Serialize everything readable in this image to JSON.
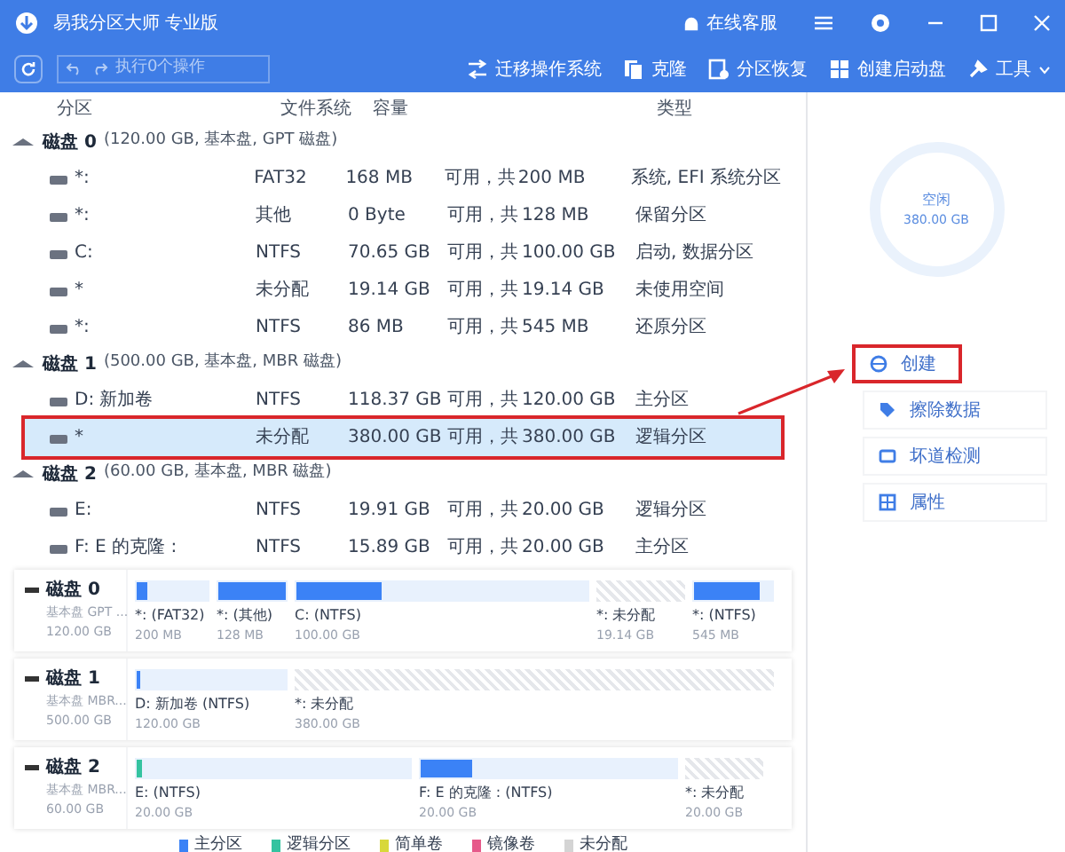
{
  "window": {
    "title": "易我分区大师 专业版",
    "support": "在线客服"
  },
  "toolbar": {
    "pending": "执行0个操作",
    "actions": [
      {
        "label": "迁移操作系统",
        "kind": "migrate"
      },
      {
        "label": "克隆",
        "kind": "clone"
      },
      {
        "label": "分区恢复",
        "kind": "recover"
      },
      {
        "label": "创建启动盘",
        "kind": "boot"
      },
      {
        "label": "工具",
        "kind": "tools"
      }
    ]
  },
  "table": {
    "columns": [
      "分区",
      "文件系统",
      "容量",
      "类型"
    ],
    "rows": [
      {
        "kind": "disk",
        "name": "磁盘 0",
        "info": "(120.00 GB, 基本盘, GPT 磁盘)"
      },
      {
        "kind": "partition",
        "name": "*:",
        "fs": "FAT32",
        "free": "168 MB",
        "sep": "可用，共",
        "total": "200 MB",
        "type": "系统, EFI 系统分区",
        "selected": false
      },
      {
        "kind": "partition",
        "name": "*:",
        "fs": "其他",
        "free": "0 Byte",
        "sep": "可用，共",
        "total": "128 MB",
        "type": "保留分区",
        "selected": false
      },
      {
        "kind": "partition",
        "name": "C:",
        "fs": "NTFS",
        "free": "70.65 GB",
        "sep": "可用，共",
        "total": "100.00 GB",
        "type": "启动, 数据分区",
        "selected": false
      },
      {
        "kind": "partition",
        "name": "*",
        "fs": "未分配",
        "free": "19.14 GB",
        "sep": "可用，共",
        "total": "19.14 GB",
        "type": "未使用空间",
        "selected": false
      },
      {
        "kind": "partition",
        "name": "*:",
        "fs": "NTFS",
        "free": "86 MB",
        "sep": "可用，共",
        "total": "545 MB",
        "type": "还原分区",
        "selected": false
      },
      {
        "kind": "disk",
        "name": "磁盘 1",
        "info": "(500.00 GB, 基本盘, MBR 磁盘)"
      },
      {
        "kind": "partition",
        "name": "D: 新加卷",
        "fs": "NTFS",
        "free": "118.37 GB",
        "sep": "可用，共",
        "total": "120.00 GB",
        "type": "主分区",
        "selected": false
      },
      {
        "kind": "partition",
        "name": "*",
        "fs": "未分配",
        "free": "380.00 GB",
        "sep": "可用，共",
        "total": "380.00 GB",
        "type": "逻辑分区",
        "selected": true
      },
      {
        "kind": "disk",
        "name": "磁盘 2",
        "info": "(60.00 GB, 基本盘, MBR 磁盘)"
      },
      {
        "kind": "partition",
        "name": "E:",
        "fs": "NTFS",
        "free": "19.91 GB",
        "sep": "可用，共",
        "total": "20.00 GB",
        "type": "逻辑分区",
        "selected": false
      },
      {
        "kind": "partition",
        "name": "F: E 的克隆 :",
        "fs": "NTFS",
        "free": "15.89 GB",
        "sep": "可用，共",
        "total": "20.00 GB",
        "type": "主分区",
        "selected": false
      }
    ]
  },
  "disk_map": [
    {
      "name": "磁盘 0",
      "kind": "基本盘 GPT ...",
      "size": "120.00 GB",
      "partitions": [
        {
          "label": "*: (FAT32)",
          "size": "200 MB",
          "kind": "primary",
          "level": 0.16
        },
        {
          "label": "*: (其他)",
          "size": "128 MB",
          "kind": "primary",
          "level": 1
        },
        {
          "label": "C: (NTFS)",
          "size": "100.00 GB",
          "kind": "primary",
          "level": 0.29
        },
        {
          "label": "*: 未分配",
          "size": "19.14 GB",
          "kind": "unallocated"
        },
        {
          "label": "*: (NTFS)",
          "size": "545 MB",
          "kind": "primary",
          "level": 0.84
        }
      ]
    },
    {
      "name": "磁盘 1",
      "kind": "基本盘 MBR...",
      "size": "500.00 GB",
      "partitions": [
        {
          "label": "D: 新加卷 (NTFS)",
          "size": "120.00 GB",
          "kind": "primary",
          "level": 0.02
        },
        {
          "label": "*: 未分配",
          "size": "380.00 GB",
          "kind": "unallocated"
        }
      ]
    },
    {
      "name": "磁盘 2",
      "kind": "基本盘 MBR...",
      "size": "60.00 GB",
      "partitions": [
        {
          "label": "E: (NTFS)",
          "size": "20.00 GB",
          "kind": "logical",
          "level": 0.01
        },
        {
          "label": "F: E 的克隆 : (NTFS)",
          "size": "20.00 GB",
          "kind": "primary",
          "level": 0.2
        },
        {
          "label": "*: 未分配",
          "size": "20.00 GB",
          "kind": "unallocated"
        }
      ]
    }
  ],
  "legend": [
    {
      "label": "主分区",
      "color": "#3b82f6"
    },
    {
      "label": "逻辑分区",
      "color": "#34c3a0"
    },
    {
      "label": "简单卷",
      "color": "#d8d83a"
    },
    {
      "label": "镜像卷",
      "color": "#e65a8a"
    },
    {
      "label": "未分配",
      "color": "#d4d4d4"
    }
  ],
  "side_panel": {
    "ring_label": "空闲",
    "ring_value": "380.00 GB",
    "actions": [
      {
        "label": "创建",
        "kind": "create",
        "selected": true
      },
      {
        "label": "擦除数据",
        "kind": "wipe",
        "selected": false
      },
      {
        "label": "坏道检测",
        "kind": "test",
        "selected": false
      },
      {
        "label": "属性",
        "kind": "props",
        "selected": false
      }
    ]
  }
}
